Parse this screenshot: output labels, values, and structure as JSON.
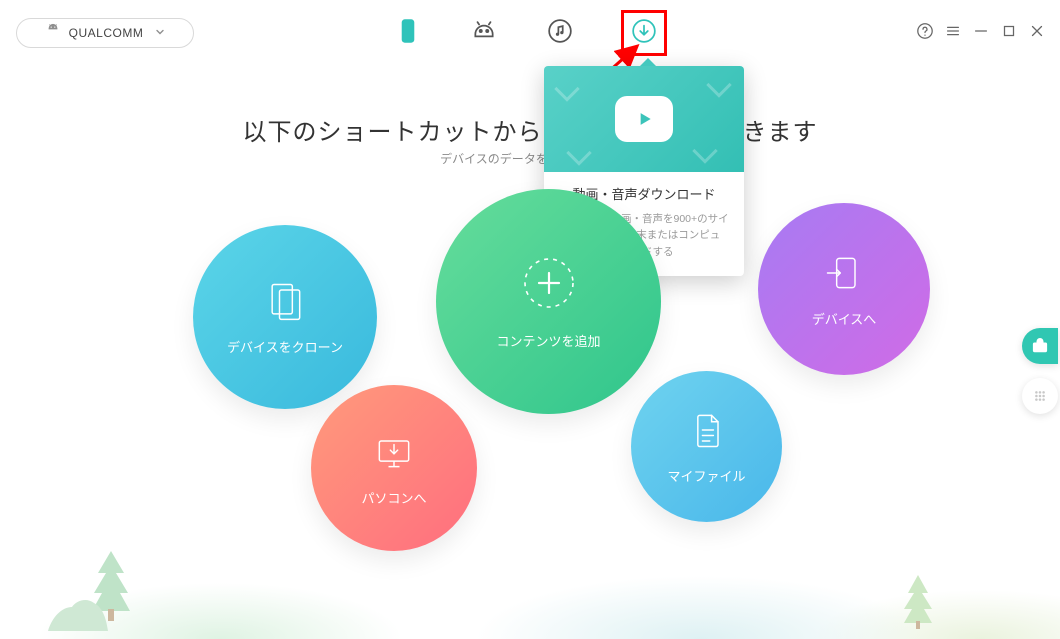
{
  "device": {
    "name": "QUALCOMM"
  },
  "heading": {
    "title": "以下のショートカットからクイック転送ができます",
    "subtitle": "デバイスのデータを読み込み中…"
  },
  "popover": {
    "title": "動画・音声ダウンロード",
    "description": "オンライン動画・音声を900+のサイトからAndroid端末またはコンピュータにダウンロードする"
  },
  "circles": {
    "clone": "デバイスをクローン",
    "add": "コンテンツを追加",
    "device": "デバイスへ",
    "pc": "パソコンへ",
    "files": "マイファイル"
  }
}
